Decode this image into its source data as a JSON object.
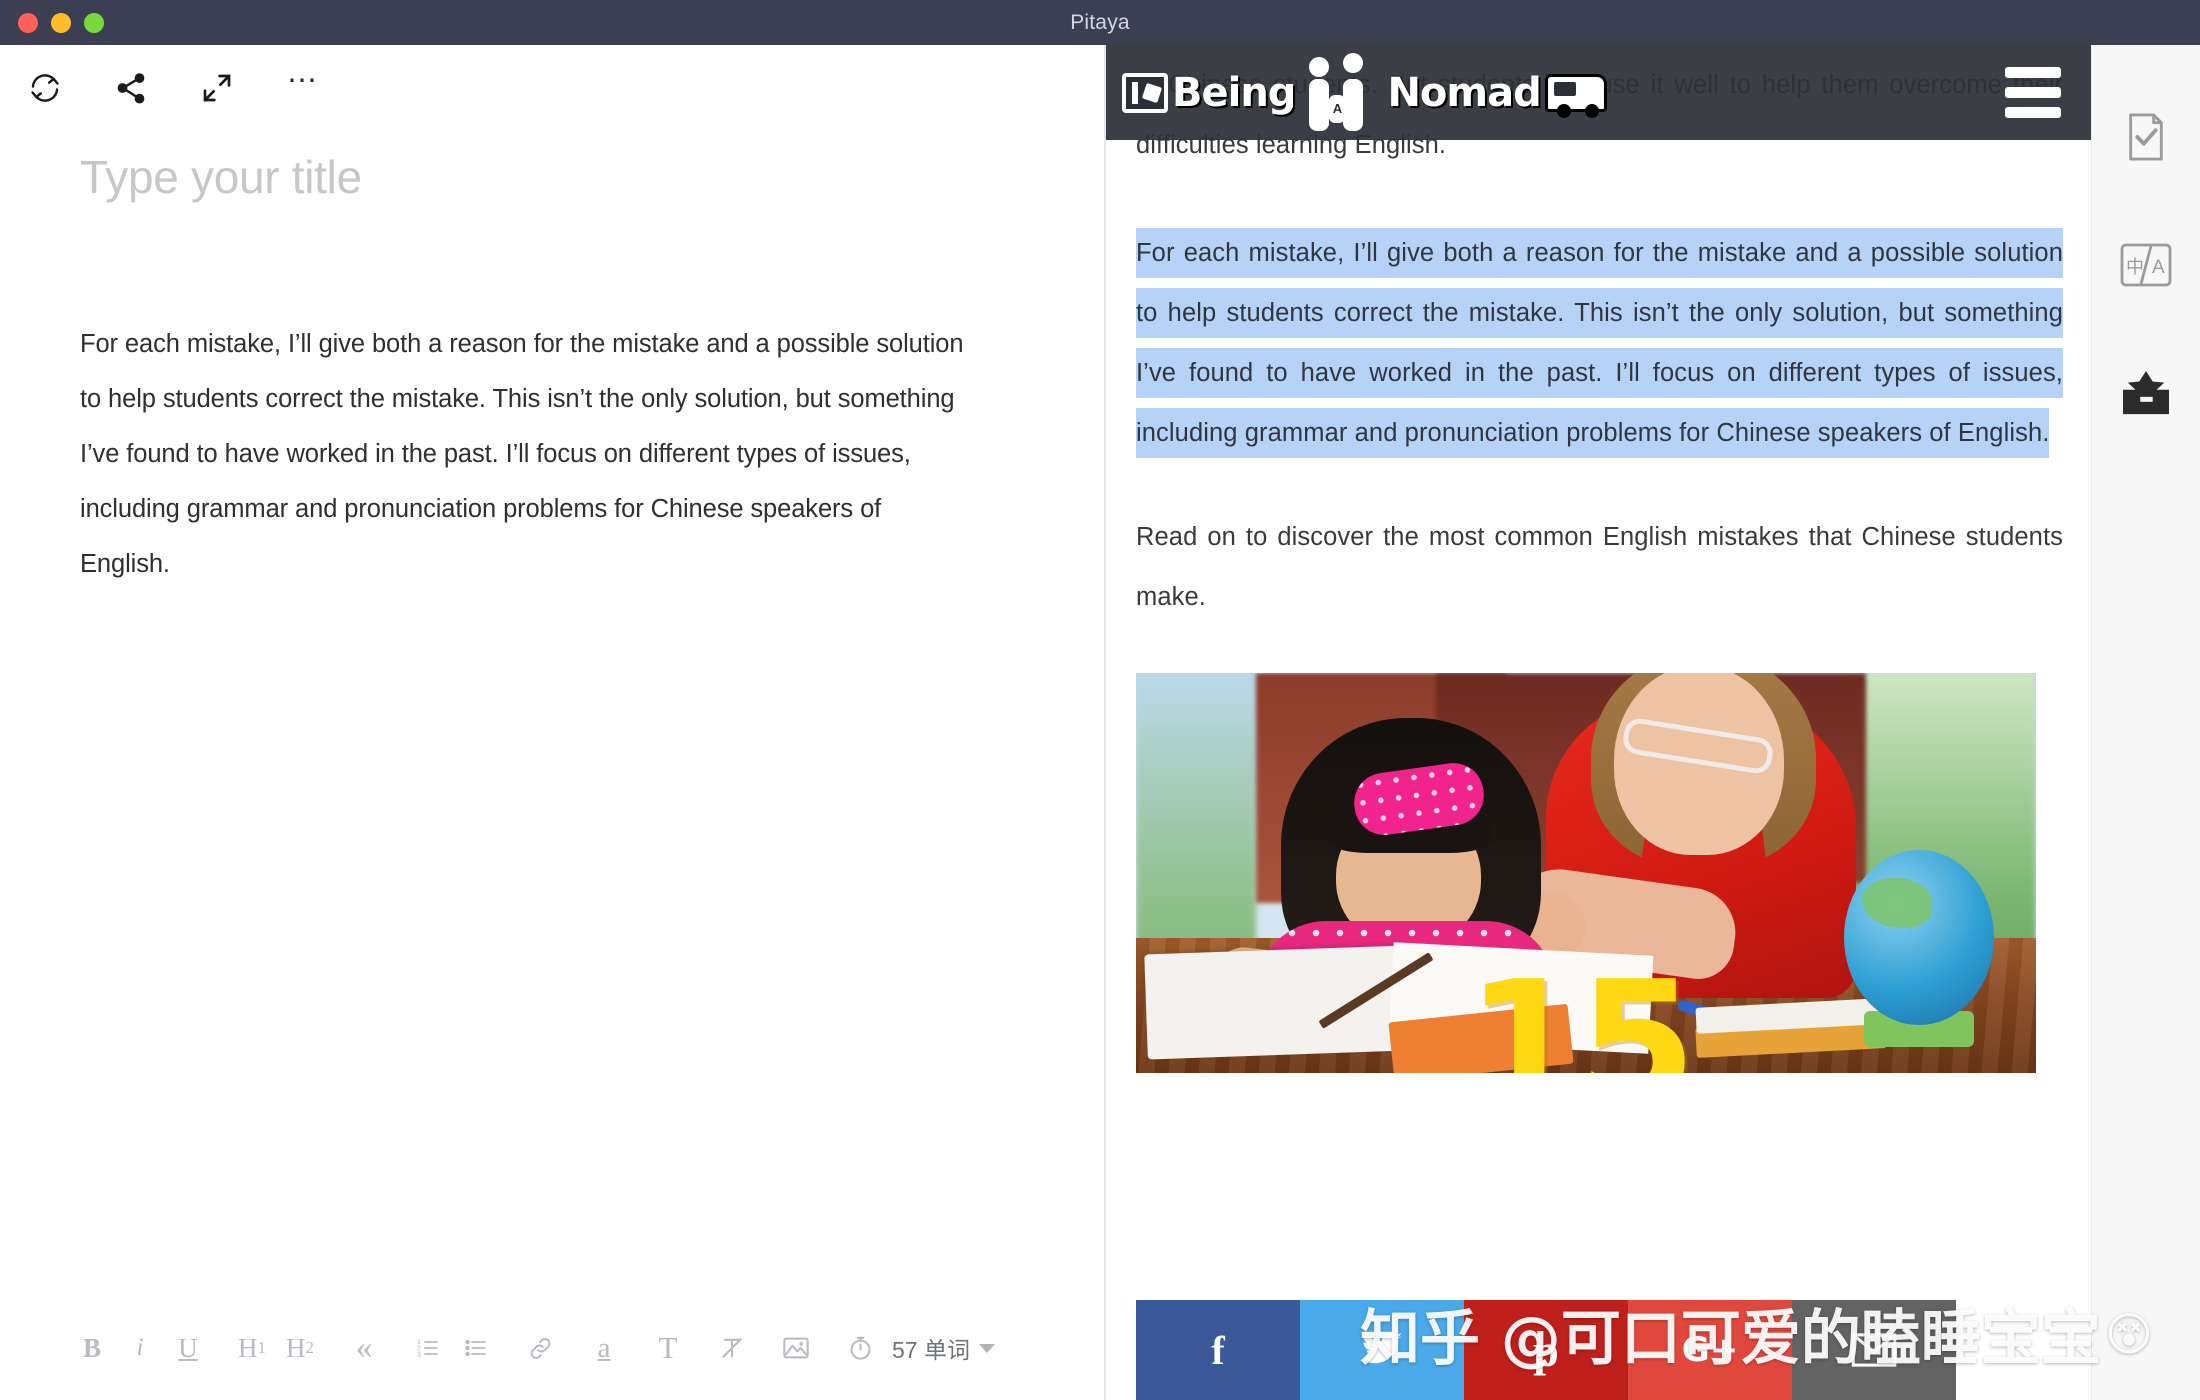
{
  "window": {
    "title": "Pitaya",
    "traffic_lights": [
      {
        "name": "close",
        "color": "#ff6159"
      },
      {
        "name": "minimize",
        "color": "#ffbd2e"
      },
      {
        "name": "maximize",
        "color": "#7ad83f"
      }
    ]
  },
  "editor": {
    "toolbar_top": [
      {
        "name": "sync-icon",
        "label": "Sync"
      },
      {
        "name": "share-icon",
        "label": "Share"
      },
      {
        "name": "fullscreen-icon",
        "label": "Fullscreen"
      },
      {
        "name": "more-options-icon",
        "label": "More"
      }
    ],
    "title_placeholder": "Type your title",
    "body_text": "For each mistake, I’ll give both a reason for the mistake and a possible solution to help students correct the mistake. This isn’t the only solution, but something I’ve found to have worked in the past. I’ll focus on different types of issues, including grammar and pronunciation problems for Chinese speakers of English.",
    "toolbar_bottom": {
      "bold_label": "B",
      "italic_label": "i",
      "underline_label": "U",
      "h1_label": "H",
      "h1_sub": "1",
      "h2_label": "H",
      "h2_sub": "2",
      "quote_label": "«",
      "ordered_list_label": "ordered-list",
      "bullet_list_label": "bullet-list",
      "link_label": "link",
      "highlight_label": "a",
      "text_color_label": "T",
      "clear_format_label": "clear-format",
      "image_label": "image",
      "timer_label": "timer",
      "word_count": "57 单词"
    }
  },
  "preview": {
    "site_header": {
      "logo_text_1": "Being",
      "logo_text_2": "Nomad",
      "menu_label": "menu"
    },
    "paragraphs": [
      {
        "id": "p-top",
        "text": "to Chinese students. But students can use it well to help them overcome their difficulties learning English.",
        "selected": false
      },
      {
        "id": "p-selected",
        "text": "For each mistake, I’ll give both a reason for the mistake and a possible solution to help students correct the mistake. This isn’t the only solution, but something I’ve found to have worked in the past. I’ll focus on different types of issues, including grammar and pronunciation problems for Chinese speakers of English.",
        "selected": true
      },
      {
        "id": "p-read-on",
        "text": "Read on to discover the most common English mistakes that Chinese students make.",
        "selected": false
      }
    ],
    "figure": {
      "name": "tutor-and-student-photo",
      "overlay_number": "15"
    },
    "social_buttons": [
      {
        "name": "facebook",
        "label": "f",
        "color": "#3b5998"
      },
      {
        "name": "twitter",
        "label": "twitter",
        "color": "#4aa9e8"
      },
      {
        "name": "pinterest",
        "label": "p",
        "color": "#c0201c"
      },
      {
        "name": "googleplus",
        "label": "G+",
        "color": "#e0483d"
      },
      {
        "name": "email",
        "label": "email",
        "color": "#636363"
      }
    ]
  },
  "right_sidebar": {
    "items": [
      {
        "name": "document-check-icon",
        "label": "Check"
      },
      {
        "name": "translate-icon",
        "label": "中/A"
      },
      {
        "name": "archive-box-icon",
        "label": "Archive"
      }
    ]
  },
  "watermark": {
    "text": "知乎 @可口可爱的瞌睡宝宝",
    "emoji": "😵"
  },
  "colors": {
    "titlebar": "#3b3f51",
    "selection": "#b6d2f7",
    "site_header": "rgba(45,47,56,0.93)",
    "sidebar_bg": "#f7f7f7"
  }
}
